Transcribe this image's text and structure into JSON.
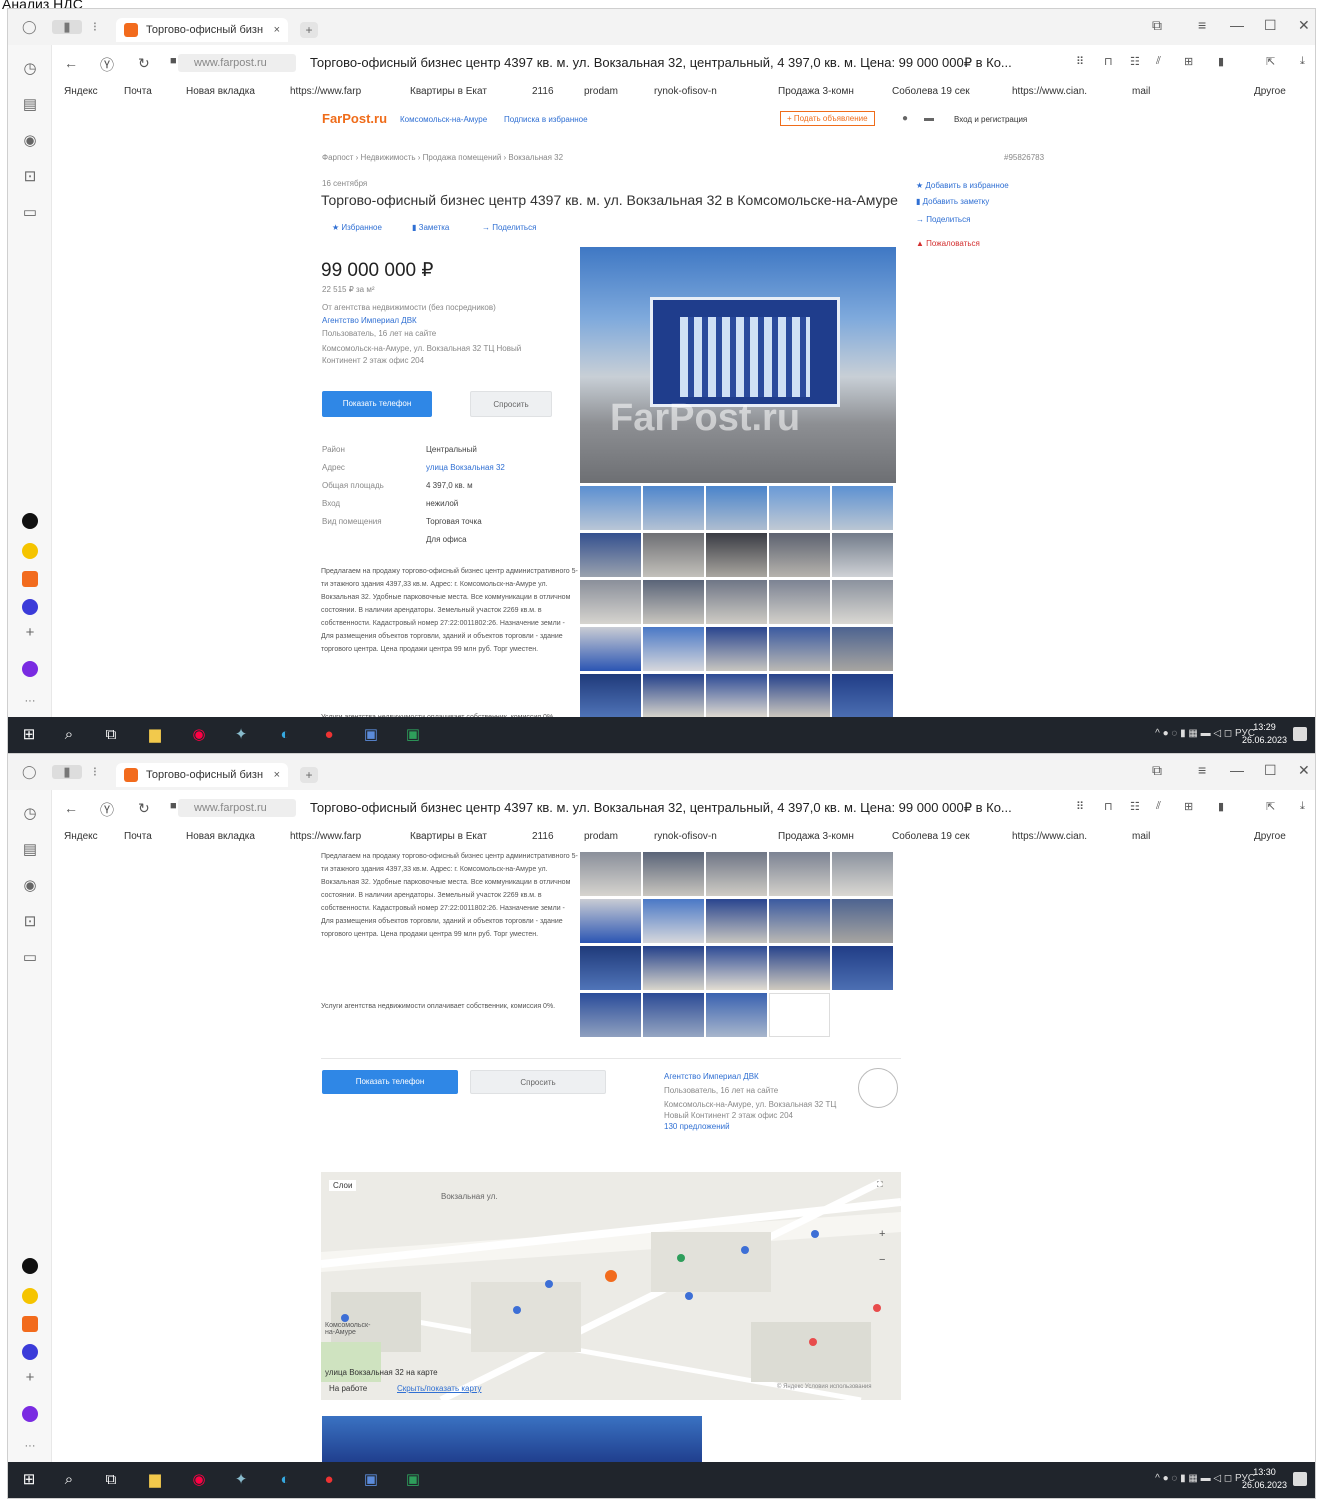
{
  "doc_label": "Анализ НДС",
  "browser": {
    "tab_title": "Торгово-офисный бизн",
    "tab_close": "×",
    "new_tab": "+",
    "url_text": "www.farpost.ru",
    "page_title": "Торгово-офисный бизнес центр 4397 кв. м. ул. Вокзальная 32, центральный, 4 397,0 кв. м. Цена: 99 000 000₽ в Ко...",
    "bookmarks": [
      "Яндекс",
      "Почта",
      "Новая вкладка",
      "https://www.farp",
      "Квартиры в Екат",
      "2116",
      "prodam",
      "rynok-ofisov-n",
      "Продажа 3-комн",
      "Соболева 19 сек",
      "https://www.cian.",
      "mail",
      "Другое"
    ]
  },
  "listing": {
    "site_logo": "FarPost.ru",
    "city": "Комсомольск-на-Амуре",
    "subscribe": "Подписка в избранное",
    "submit_ad": "+ Подать объявление",
    "login": "Вход и регистрация",
    "breadcrumb": "Фарпост › Недвижимость › Продажа помещений › Вокзальная 32",
    "ad_id": "#95826783",
    "date": "16 сентября",
    "title": "Торгово-офисный бизнес центр 4397 кв. м. ул. Вокзальная 32 в Комсомольске-на-Амуре",
    "actions": [
      "Избранное",
      "Заметка",
      "Поделиться"
    ],
    "side_actions": [
      "Добавить в избранное",
      "Добавить заметку",
      "Поделиться",
      "Пожаловаться"
    ],
    "price": "99 000 000 ₽",
    "price_per_m": "22 515 ₽ за м²",
    "agency_note": "От агентства недвижимости (без посредников)",
    "agency_name": "Агентство Империал ДВК",
    "agency_info": "Пользователь, 16 лет на сайте",
    "agency_addr": "Комсомольск-на-Амуре, ул. Вокзальная 32 ТЦ Новый Континент 2 этаж офис 204",
    "show_phone": "Показать телефон",
    "ask": "Спросить",
    "props": [
      {
        "k": "Район",
        "v": "Центральный"
      },
      {
        "k": "Адрес",
        "v": "улица Вокзальная 32"
      },
      {
        "k": "Общая площадь",
        "v": "4 397,0 кв. м"
      },
      {
        "k": "Вход",
        "v": "нежилой"
      },
      {
        "k": "Вид помещения",
        "v": "Торговая точка"
      }
    ],
    "props_extra": "Для офиса",
    "description": "Предлагаем на продажу торгово-офисный бизнес центр административного 5-ти этажного здания 4397,33 кв.м. Адрес: г. Комсомольск-на-Амуре ул. Вокзальная 32. Удобные парковочные места. Все коммуникации в отличном состоянии. В наличии арендаторы. Земельный участок 2269 кв.м. в собственности. Кадастровый номер 27:22:0011802:26. Назначение земли - Для размещения объектов торговли, зданий и объектов торговли - здание торгового центра. Цена продажи центра 99 млн руб. Торг уместен.",
    "agency_commission": "Услуги агентства недвижимости оплачивает собственник, комиссия 0%.",
    "watermark": "FarPost.ru",
    "agency_block_offers": "130 предложений"
  },
  "map": {
    "layers": "Слои",
    "street_top": "Вокзальная ул.",
    "footer_addr": "улица Вокзальная 32 на карте",
    "footer_fav": "На работе",
    "footer_link": "Скрыть/показать карту",
    "yandex": "© Яндекс Условия использования",
    "district": "Комсомольск-на-Амуре"
  },
  "taskbar": {
    "tray_lang": "РУС",
    "time1": "13:29",
    "time2": "13:30",
    "date": "26.06.2023"
  }
}
